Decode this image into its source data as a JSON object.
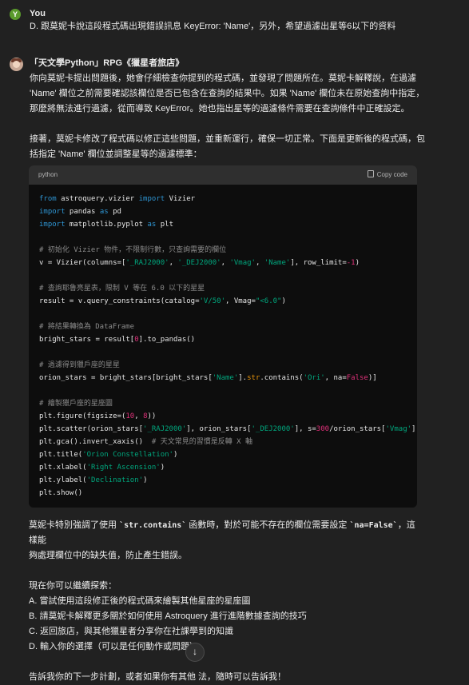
{
  "user": {
    "avatar_letter": "Y",
    "name": "You",
    "message": "D. 跟莫妮卡說這段程式碼出現錯誤訊息 KeyError: 'Name'，另外，希望過濾出星等6以下的資料"
  },
  "assistant": {
    "name": "「天文學Python」RPG《獵星者旅店》",
    "intro_paragraphs": [
      "你向莫妮卡提出問題後，她會仔細檢查你提到的程式碼，並發現了問題所在。莫妮卡解釋說，在過濾",
      "'Name' 欄位之前需要確認該欄位是否已包含在查詢的結果中。如果 'Name' 欄位未在原始查詢中指定，",
      "那麼將無法進行過濾，從而導致 KeyError。她也指出星等的過濾條件需要在查詢條件中正確設定。"
    ],
    "second_paragraphs": [
      "接著，莫妮卡修改了程式碼以修正這些問題，並重新運行，確保一切正常。下面是更新後的程式碼，包",
      "括指定 'Name' 欄位並調整星等的過濾標準："
    ],
    "code": {
      "language": "python",
      "copy_label": "Copy code"
    },
    "after_para_1": "莫妮卡特別強調了使用 ",
    "after_code_1": "`str.contains`",
    "after_para_2": " 函數時，對於可能不存在的欄位需要設定 ",
    "after_code_2": "`na=False`",
    "after_para_3": "，這樣能",
    "after_para_line2": "夠處理欄位中的缺失值，防止產生錯誤。",
    "options_intro": "現在你可以繼續探索：",
    "options": [
      "A. 嘗試使用這段修正後的程式碼來繪製其他星座的星座圖",
      "B. 請莫妮卡解釋更多關於如何使用 Astroquery 進行進階數據查詢的技巧",
      "C. 返回旅店，與其他獵星者分享你在社課學到的知識",
      "D. 輸入你的選擇（可以是任何動作或問題）"
    ],
    "closing": "告訴我你的下一步計劃，或者如果你有其他            法，隨時可以告訴我！"
  },
  "scroll_button_icon": "arrow-down-icon"
}
